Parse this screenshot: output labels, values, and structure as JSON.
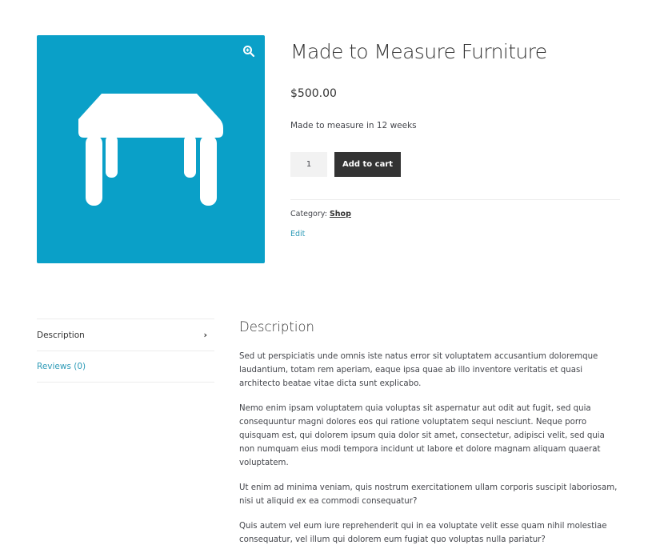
{
  "product": {
    "title": "Made to Measure Furniture",
    "price": "$500.00",
    "short_description": "Made to measure in 12 weeks",
    "quantity": "1",
    "add_to_cart_label": "Add to cart",
    "category_label": "Category:",
    "category_value": "Shop",
    "edit_label": "Edit",
    "image_icon": "table-icon",
    "image_bg_color": "#0aa0c8"
  },
  "tabs": [
    {
      "label": "Description",
      "active": true
    },
    {
      "label": "Reviews (0)",
      "active": false
    }
  ],
  "description": {
    "heading": "Description",
    "paragraphs": [
      "Sed ut perspiciatis unde omnis iste natus error sit voluptatem accusantium doloremque laudantium, totam rem aperiam, eaque ipsa quae ab illo inventore veritatis et quasi architecto beatae vitae dicta sunt explicabo.",
      "Nemo enim ipsam voluptatem quia voluptas sit aspernatur aut odit aut fugit, sed quia consequuntur magni dolores eos qui ratione voluptatem sequi nesciunt. Neque porro quisquam est, qui dolorem ipsum quia dolor sit amet, consectetur, adipisci velit, sed quia non numquam eius modi tempora incidunt ut labore et dolore magnam aliquam quaerat voluptatem.",
      "Ut enim ad minima veniam, quis nostrum exercitationem ullam corporis suscipit laboriosam, nisi ut aliquid ex ea commodi consequatur?",
      "Quis autem vel eum iure reprehenderit qui in ea voluptate velit esse quam nihil molestiae consequatur, vel illum qui dolorem eum fugiat quo voluptas nulla pariatur?"
    ]
  },
  "colors": {
    "accent": "#2c9ab7",
    "button": "#333333"
  }
}
